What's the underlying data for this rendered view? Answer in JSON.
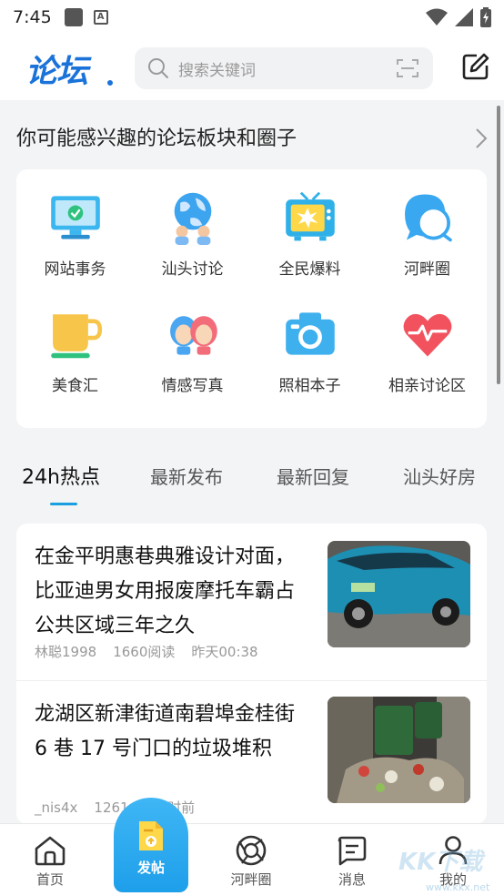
{
  "status_bar": {
    "time": "7:45"
  },
  "header": {
    "logo_text": "论坛",
    "search_placeholder": "搜索关键词"
  },
  "section": {
    "title": "你可能感兴趣的论坛板块和圈子"
  },
  "categories": [
    {
      "label": "网站事务",
      "icon": "monitor-check-icon"
    },
    {
      "label": "汕头讨论",
      "icon": "globe-people-icon"
    },
    {
      "label": "全民爆料",
      "icon": "tv-burst-icon"
    },
    {
      "label": "河畔圈",
      "icon": "chat-bubble-icon"
    },
    {
      "label": "美食汇",
      "icon": "cup-icon"
    },
    {
      "label": "情感写真",
      "icon": "couple-icon"
    },
    {
      "label": "照相本子",
      "icon": "camera-icon"
    },
    {
      "label": "相亲讨论区",
      "icon": "heart-pulse-icon"
    }
  ],
  "tabs": [
    {
      "label": "24h热点",
      "active": true
    },
    {
      "label": "最新发布",
      "active": false
    },
    {
      "label": "最新回复",
      "active": false
    },
    {
      "label": "汕头好房",
      "active": false
    }
  ],
  "posts": [
    {
      "title": "在金平明惠巷典雅设计对面，比亚迪男女用报废摩托车霸占公共区域三年之久",
      "author": "林聪1998",
      "reads": "1660阅读",
      "time": "昨天00:38"
    },
    {
      "title": "龙湖区新津街道南碧埠金桂街 6 巷 17 号门口的垃圾堆积",
      "author": "_nis4x",
      "reads": "1261",
      "time": "8小时前"
    }
  ],
  "bottom_nav": {
    "home": "首页",
    "post": "发帖",
    "circle": "河畔圈",
    "messages": "消息",
    "mine": "我的"
  },
  "watermark": {
    "text": "KK下载",
    "sub": "www.kkx.net"
  },
  "colors": {
    "accent": "#1a9fe0",
    "logo": "#1a73d9"
  }
}
